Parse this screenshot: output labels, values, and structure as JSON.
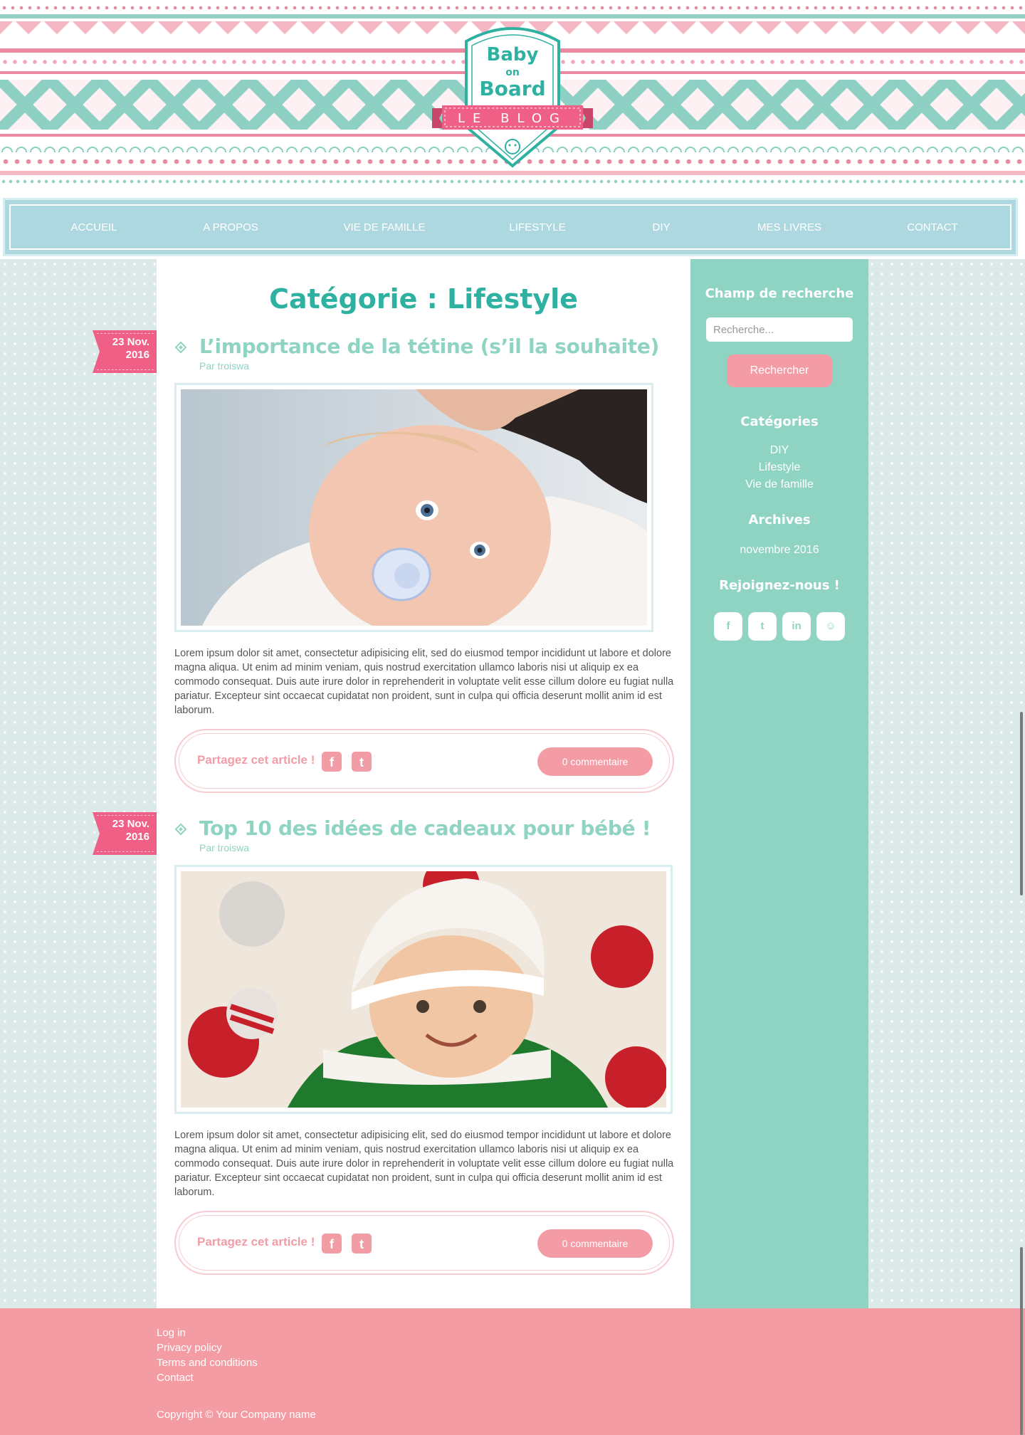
{
  "logo": {
    "line1": "Baby",
    "line2": "on",
    "line3": "Board",
    "ribbon": "LE BLOG"
  },
  "nav": {
    "items": [
      {
        "label": "ACCUEIL"
      },
      {
        "label": "A PROPOS"
      },
      {
        "label": "VIE DE FAMILLE"
      },
      {
        "label": "LIFESTYLE"
      },
      {
        "label": "DIY"
      },
      {
        "label": "MES LIVRES"
      },
      {
        "label": "CONTACT"
      }
    ]
  },
  "main": {
    "page_title": "Catégorie : Lifestyle",
    "articles": [
      {
        "date_day": "23 Nov.",
        "date_year": "2016",
        "title": "L’importance de la tétine (s’il la souhaite)",
        "author": "Par troiswa",
        "image": "baby-with-pacifier-photo",
        "body": "Lorem ipsum dolor sit amet, consectetur adipisicing elit, sed do eiusmod tempor incididunt ut labore et dolore magna aliqua. Ut enim ad minim veniam, quis nostrud exercitation ullamco laboris nisi ut aliquip ex ea commodo consequat. Duis aute irure dolor in reprehenderit in voluptate velit esse cillum dolore eu fugiat nulla pariatur. Excepteur sint occaecat cupidatat non proident, sunt in culpa qui officia deserunt mollit anim id est laborum.",
        "share_label": "Partagez cet article !",
        "comments": "0 commentaire"
      },
      {
        "date_day": "23 Nov.",
        "date_year": "2016",
        "title": "Top 10 des idées de cadeaux pour bébé !",
        "author": "Par troiswa",
        "image": "baby-in-christmas-hat-photo",
        "body": "Lorem ipsum dolor sit amet, consectetur adipisicing elit, sed do eiusmod tempor incididunt ut labore et dolore magna aliqua. Ut enim ad minim veniam, quis nostrud exercitation ullamco laboris nisi ut aliquip ex ea commodo consequat. Duis aute irure dolor in reprehenderit in voluptate velit esse cillum dolore eu fugiat nulla pariatur. Excepteur sint occaecat cupidatat non proident, sunt in culpa qui officia deserunt mollit anim id est laborum.",
        "share_label": "Partagez cet article !",
        "comments": "0 commentaire"
      }
    ]
  },
  "sidebar": {
    "search_heading": "Champ de recherche",
    "search_placeholder": "Recherche...",
    "search_button": "Rechercher",
    "categories_heading": "Catégories",
    "categories": [
      "DIY",
      "Lifestyle",
      "Vie de famille"
    ],
    "archives_heading": "Archives",
    "archives": [
      "novembre 2016"
    ],
    "social_heading": "Rejoignez-nous !",
    "social": [
      {
        "icon": "facebook-icon",
        "glyph": "f"
      },
      {
        "icon": "twitter-icon",
        "glyph": "t"
      },
      {
        "icon": "linkedin-icon",
        "glyph": "in"
      },
      {
        "icon": "github-icon",
        "glyph": "☺"
      }
    ]
  },
  "footer": {
    "links": [
      "Log in",
      "Privacy policy",
      "Terms and conditions",
      "Contact"
    ],
    "copyright": "Copyright © Your Company name"
  },
  "colors": {
    "teal": "#2fb1a2",
    "mint": "#8fd3c3",
    "nav_blue": "#aed8df",
    "pink": "#f49ca5",
    "ribbon_pink": "#ef5f86"
  }
}
